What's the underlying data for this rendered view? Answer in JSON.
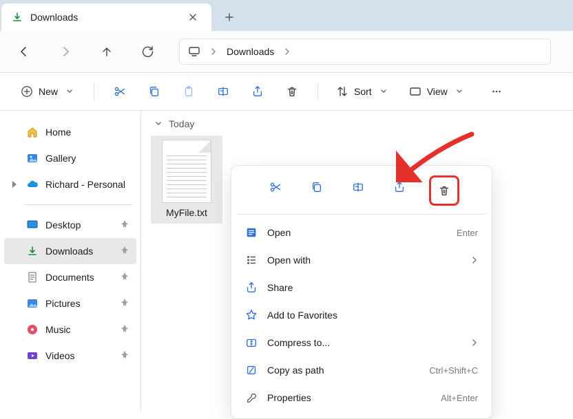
{
  "colors": {
    "accent": "#2e6fd9",
    "highlight": "#e5302b"
  },
  "tab": {
    "title": "Downloads"
  },
  "breadcrumb": {
    "parts": [
      "Downloads"
    ]
  },
  "cmdbar": {
    "new_label": "New",
    "sort_label": "Sort",
    "view_label": "View"
  },
  "sidebar": {
    "quick": [
      {
        "id": "home",
        "label": "Home"
      },
      {
        "id": "gallery",
        "label": "Gallery"
      },
      {
        "id": "cloud",
        "label": "Richard - Personal"
      }
    ],
    "folders": [
      {
        "id": "desktop",
        "label": "Desktop",
        "pinned": true
      },
      {
        "id": "downloads",
        "label": "Downloads",
        "pinned": true,
        "selected": true
      },
      {
        "id": "documents",
        "label": "Documents",
        "pinned": true
      },
      {
        "id": "pictures",
        "label": "Pictures",
        "pinned": true
      },
      {
        "id": "music",
        "label": "Music",
        "pinned": true
      },
      {
        "id": "videos",
        "label": "Videos",
        "pinned": true
      }
    ]
  },
  "main": {
    "group_header": "Today",
    "file": {
      "name": "MyFile.txt"
    }
  },
  "context_menu": {
    "items": [
      {
        "id": "open",
        "label": "Open",
        "accel": "Enter"
      },
      {
        "id": "open-with",
        "label": "Open with",
        "submenu": true
      },
      {
        "id": "share",
        "label": "Share"
      },
      {
        "id": "favorites",
        "label": "Add to Favorites"
      },
      {
        "id": "compress",
        "label": "Compress to...",
        "submenu": true
      },
      {
        "id": "copy-path",
        "label": "Copy as path",
        "accel": "Ctrl+Shift+C"
      },
      {
        "id": "properties",
        "label": "Properties",
        "accel": "Alt+Enter"
      }
    ]
  }
}
